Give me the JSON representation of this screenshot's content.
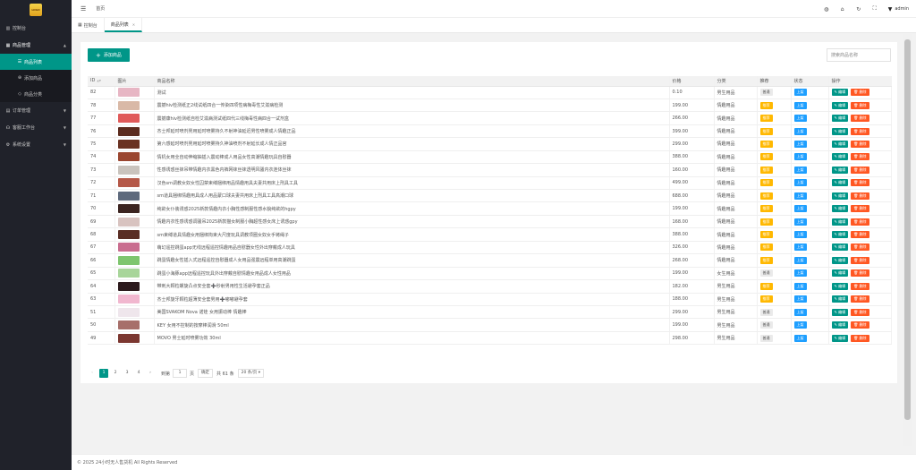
{
  "sidebar": {
    "logo_text": "LOGO",
    "items": [
      {
        "label": "控制台",
        "icon": "dashboard-icon"
      },
      {
        "label": "商品管理",
        "icon": "grid-icon",
        "open": true,
        "children": [
          {
            "label": "商品列表",
            "icon": "list-icon",
            "active": true
          },
          {
            "label": "添加商品",
            "icon": "plus-circle-icon"
          },
          {
            "label": "商品分类",
            "icon": "tag-icon"
          }
        ]
      },
      {
        "label": "订单管理",
        "icon": "order-icon"
      },
      {
        "label": "客服工作台",
        "icon": "headset-icon"
      },
      {
        "label": "系统设置",
        "icon": "gear-icon"
      }
    ]
  },
  "header": {
    "home_label": "首页",
    "user_name": "admin"
  },
  "tabs": [
    {
      "label": "控制台",
      "icon": "grid-icon"
    },
    {
      "label": "商品列表",
      "active": true
    }
  ],
  "toolbar": {
    "add_label": "添加商品",
    "search_placeholder": "搜索商品名称"
  },
  "table": {
    "columns": [
      "ID",
      "图片",
      "商品名称",
      "价格",
      "分类",
      "推荐",
      "状态",
      "操作"
    ],
    "edit_label": "编辑",
    "delete_label": "删除",
    "rows": [
      {
        "id": "82",
        "name": "测试",
        "price": "0.10",
        "category": "男生用品",
        "recommend": "普通",
        "status": "上架",
        "thumb": "#e7b6c4"
      },
      {
        "id": "78",
        "name": "震撼hiv检测纸正2线试纸四合一传染四项性病梅毒性艾滋病检测",
        "price": "199.00",
        "category": "情趣用品",
        "recommend": "推荐",
        "status": "上架",
        "thumb": "#d9b9a7"
      },
      {
        "id": "77",
        "name": "震撼康hiv检测纸自检艾滋病测试纸四代三线梅毒性病四合一试剂盒",
        "price": "266.00",
        "category": "情趣用品",
        "recommend": "推荐",
        "status": "上架",
        "thumb": "#e05a5a"
      },
      {
        "id": "76",
        "name": "杰士邦延时喷剂男用延时喷雾持久不射神油延迟男性喷雾成人情趣正品",
        "price": "399.00",
        "category": "情趣用品",
        "recommend": "推荐",
        "status": "上架",
        "thumb": "#5b2b1e"
      },
      {
        "id": "75",
        "name": "第六感延时喷剂男用延时喷雾持久神油喷剂不射延长成人情正品官",
        "price": "299.00",
        "category": "情趣用品",
        "recommend": "推荐",
        "status": "上架",
        "thumb": "#6a3222"
      },
      {
        "id": "74",
        "name": "情机女用全自动伸缩抽插入震动棒成人用品女性高潮情趣玩具自慰器",
        "price": "388.00",
        "category": "情趣用品",
        "recommend": "推荐",
        "status": "上架",
        "thumb": "#9a4630"
      },
      {
        "id": "73",
        "name": "性感诱惑丝袜吊带情趣内衣黑色内裤网袜丝袜透明风骚内衣连体丝袜",
        "price": "160.00",
        "category": "情趣用品",
        "recommend": "推荐",
        "status": "上架",
        "thumb": "#c9c3bd"
      },
      {
        "id": "72",
        "name": "汉色sm调教女奴女性囚禁束缚捆绑用品情趣用具夫妻共用床上刑具工具",
        "price": "499.00",
        "category": "情趣用品",
        "recommend": "推荐",
        "status": "上架",
        "thumb": "#b55848"
      },
      {
        "id": "71",
        "name": "sm道具捆绑情趣用具成人用品蒙口球夫妻共用床上刑具工具高潮口球",
        "price": "688.00",
        "category": "情趣用品",
        "recommend": "推荐",
        "status": "上架",
        "thumb": "#5e6a7d"
      },
      {
        "id": "70",
        "name": "纯欲女仆装诱惑2025新款情趣内衣小胸性感制服性感水貌纯欲的hgpy",
        "price": "199.00",
        "category": "情趣用品",
        "recommend": "推荐",
        "status": "上架",
        "thumb": "#3b2420"
      },
      {
        "id": "69",
        "name": "情趣内衣性感诱惑调骚吊2025新款猫女制服小胸超性感女床上诱惑gpy",
        "price": "168.00",
        "category": "情趣用品",
        "recommend": "推荐",
        "status": "上架",
        "thumb": "#d8c3c0"
      },
      {
        "id": "68",
        "name": "sm束缚道具情趣女用捆绑拘束大尺度玩具调教项圈女奴女手铐绳子",
        "price": "388.00",
        "category": "情趣用品",
        "recommend": "推荐",
        "status": "上架",
        "thumb": "#5a2e24"
      },
      {
        "id": "67",
        "name": "萌幻遥控跳蛋app无线远程遥控情趣用品自慰器女性外出穿戴成人玩具",
        "price": "326.00",
        "category": "情趣用品",
        "recommend": "推荐",
        "status": "上架",
        "thumb": "#c96d8f"
      },
      {
        "id": "66",
        "name": "跳蛋情趣女性插入式远程遥控自慰器成人女用品强震远程单用高潮跳蛋",
        "price": "268.00",
        "category": "情趣用品",
        "recommend": "推荐",
        "status": "上架",
        "thumb": "#7ec56e"
      },
      {
        "id": "65",
        "name": "跳蛋小海豚app远程遥控玩具外出穿戴自慰情趣女用品成人女性用品",
        "price": "199.00",
        "category": "女生用品",
        "recommend": "普通",
        "status": "上架",
        "thumb": "#a8d59a"
      },
      {
        "id": "64",
        "name": "带刺大颗粒螺旋凸点安全套➕秒射男用性生活避孕套正品",
        "price": "182.00",
        "category": "男生用品",
        "recommend": "推荐",
        "status": "上架",
        "thumb": "#2c1a1d"
      },
      {
        "id": "63",
        "name": "杰士邦旋牙颗粒超薄安全套男用➕嘟嘟避孕套",
        "price": "188.00",
        "category": "男生用品",
        "recommend": "推荐",
        "status": "上架",
        "thumb": "#f1b7cf"
      },
      {
        "id": "51",
        "name": "美国SVAKOM Nova 诺娃 女用振动棒 情趣棒",
        "price": "299.00",
        "category": "男生用品",
        "recommend": "普通",
        "status": "上架",
        "thumb": "#efe6ec"
      },
      {
        "id": "50",
        "name": "KEY 女用不控制的按摩棒润滑 50ml",
        "price": "199.00",
        "category": "男生用品",
        "recommend": "普通",
        "status": "上架",
        "thumb": "#a76f6a"
      },
      {
        "id": "49",
        "name": "MOVO 男士延时喷雾功效 30ml",
        "price": "298.00",
        "category": "男生用品",
        "recommend": "普通",
        "status": "上架",
        "thumb": "#7b3730"
      }
    ]
  },
  "pagination": {
    "pages": [
      "1",
      "2",
      "3",
      "4"
    ],
    "goto_label": "到第",
    "goto_value": "1",
    "page_unit": "页",
    "confirm_label": "确定",
    "total_label": "共 61 条",
    "per_page_label": "20 条/页"
  },
  "footer": {
    "copyright": "© 2025 24小时无人售货机 All Rights Reserved"
  }
}
